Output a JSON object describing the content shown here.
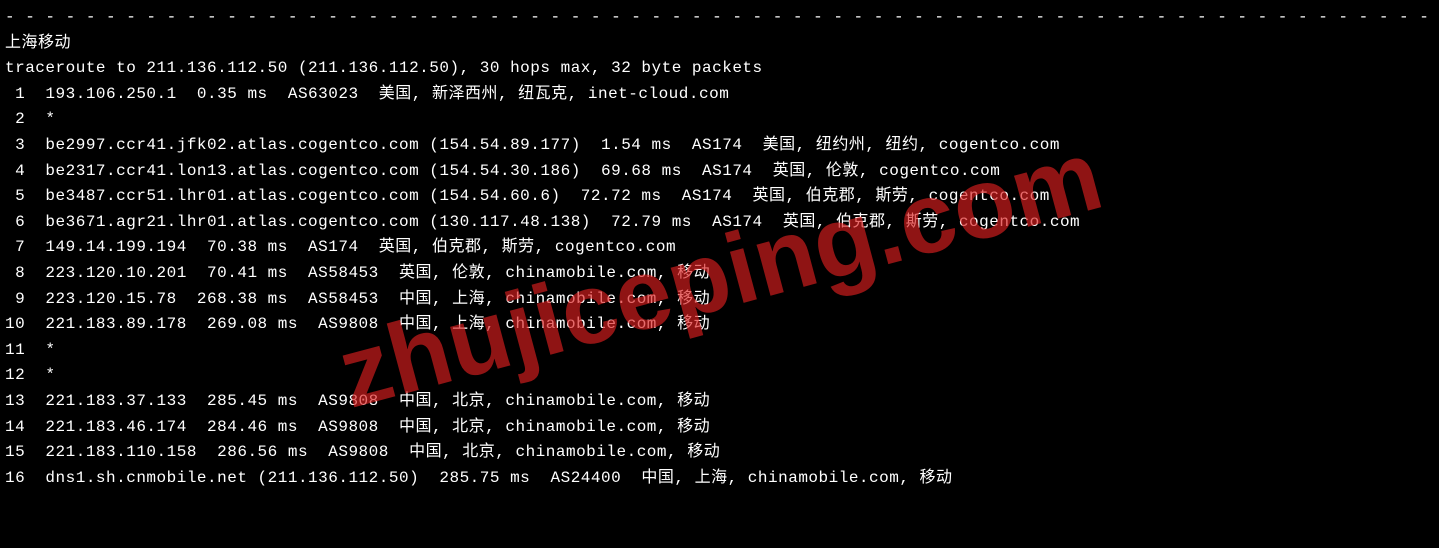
{
  "divider": "- - - - - - - - - - - - - - - - - - - - - - - - - - - - - - - - - - - - - - - - - - - - - - - - - - - - - - - - - - - - - - - - - - - - - - - - - - -",
  "header_title": "上海移动",
  "traceroute_header": "traceroute to 211.136.112.50 (211.136.112.50), 30 hops max, 32 byte packets",
  "watermark": "zhujiceping.com",
  "hops": [
    {
      "num": " 1",
      "text": "  193.106.250.1  0.35 ms  AS63023  美国, 新泽西州, 纽瓦克, inet-cloud.com"
    },
    {
      "num": " 2",
      "text": "  *"
    },
    {
      "num": " 3",
      "text": "  be2997.ccr41.jfk02.atlas.cogentco.com (154.54.89.177)  1.54 ms  AS174  美国, 纽约州, 纽约, cogentco.com"
    },
    {
      "num": " 4",
      "text": "  be2317.ccr41.lon13.atlas.cogentco.com (154.54.30.186)  69.68 ms  AS174  英国, 伦敦, cogentco.com"
    },
    {
      "num": " 5",
      "text": "  be3487.ccr51.lhr01.atlas.cogentco.com (154.54.60.6)  72.72 ms  AS174  英国, 伯克郡, 斯劳, cogentco.com"
    },
    {
      "num": " 6",
      "text": "  be3671.agr21.lhr01.atlas.cogentco.com (130.117.48.138)  72.79 ms  AS174  英国, 伯克郡, 斯劳, cogentco.com"
    },
    {
      "num": " 7",
      "text": "  149.14.199.194  70.38 ms  AS174  英国, 伯克郡, 斯劳, cogentco.com"
    },
    {
      "num": " 8",
      "text": "  223.120.10.201  70.41 ms  AS58453  英国, 伦敦, chinamobile.com, 移动"
    },
    {
      "num": " 9",
      "text": "  223.120.15.78  268.38 ms  AS58453  中国, 上海, chinamobile.com, 移动"
    },
    {
      "num": "10",
      "text": "  221.183.89.178  269.08 ms  AS9808  中国, 上海, chinamobile.com, 移动"
    },
    {
      "num": "11",
      "text": "  *"
    },
    {
      "num": "12",
      "text": "  *"
    },
    {
      "num": "13",
      "text": "  221.183.37.133  285.45 ms  AS9808  中国, 北京, chinamobile.com, 移动"
    },
    {
      "num": "14",
      "text": "  221.183.46.174  284.46 ms  AS9808  中国, 北京, chinamobile.com, 移动"
    },
    {
      "num": "15",
      "text": "  221.183.110.158  286.56 ms  AS9808  中国, 北京, chinamobile.com, 移动"
    },
    {
      "num": "16",
      "text": "  dns1.sh.cnmobile.net (211.136.112.50)  285.75 ms  AS24400  中国, 上海, chinamobile.com, 移动"
    }
  ]
}
